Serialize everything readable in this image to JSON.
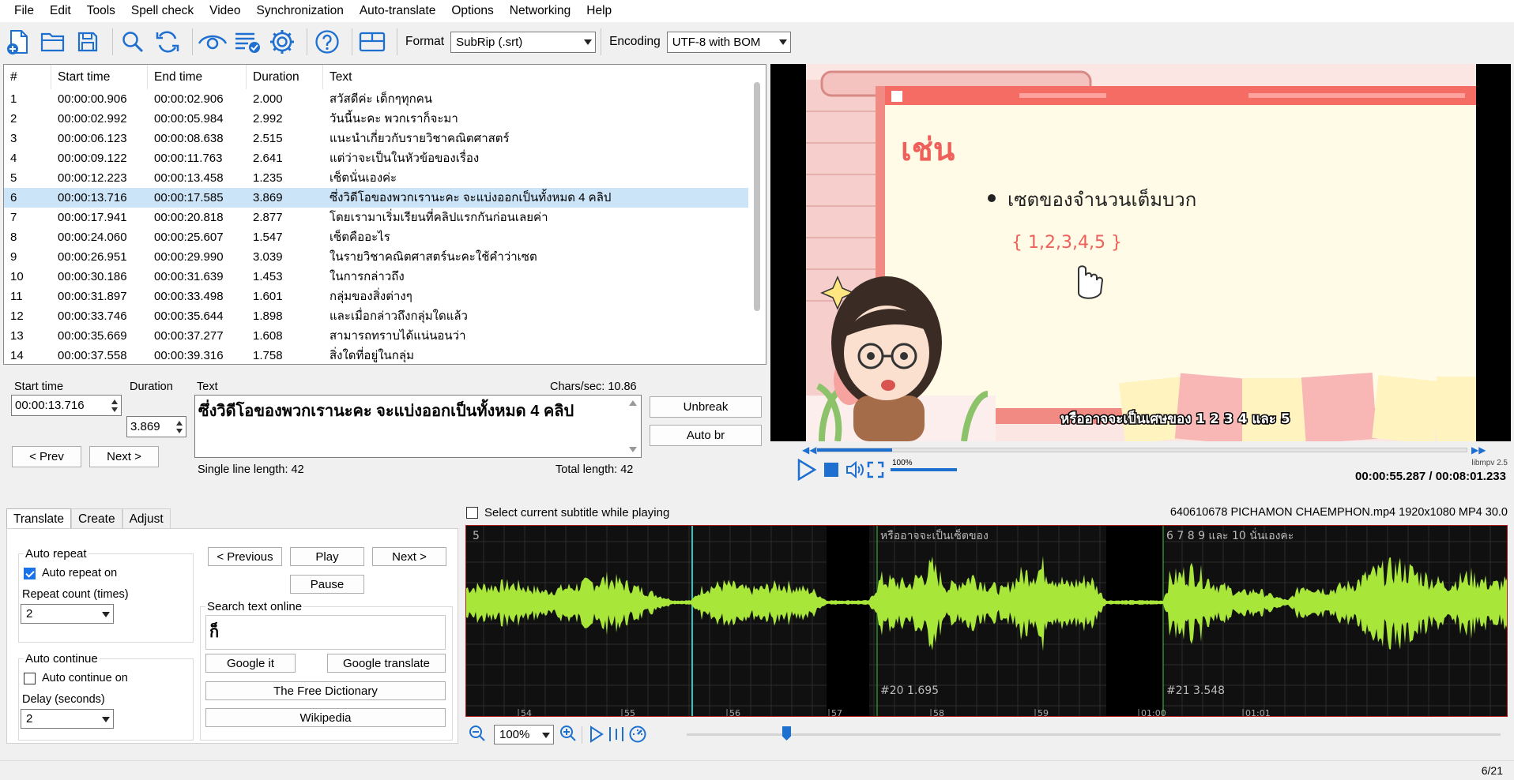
{
  "menu": [
    "File",
    "Edit",
    "Tools",
    "Spell check",
    "Video",
    "Synchronization",
    "Auto-translate",
    "Options",
    "Networking",
    "Help"
  ],
  "toolbar": {
    "icons": [
      "new-file-icon",
      "open-folder-icon",
      "save-icon",
      "find-icon",
      "replace-icon",
      "visual-sync-icon",
      "spell-check-icon",
      "settings-icon",
      "help-icon",
      "layout-icon"
    ],
    "format_label": "Format",
    "format_value": "SubRip (.srt)",
    "encoding_label": "Encoding",
    "encoding_value": "UTF-8 with BOM"
  },
  "list": {
    "columns": [
      "#",
      "Start time",
      "End time",
      "Duration",
      "Text"
    ],
    "selected_index": 5,
    "rows": [
      [
        "1",
        "00:00:00.906",
        "00:00:02.906",
        "2.000",
        "สวัสดีค่ะ เด็กๆทุกคน"
      ],
      [
        "2",
        "00:00:02.992",
        "00:00:05.984",
        "2.992",
        "วันนี้นะคะ พวกเราก็จะมา"
      ],
      [
        "3",
        "00:00:06.123",
        "00:00:08.638",
        "2.515",
        "แนะนำเกี่ยวกับรายวิชาคณิตศาสตร์"
      ],
      [
        "4",
        "00:00:09.122",
        "00:00:11.763",
        "2.641",
        "แต่ว่าจะเป็นในหัวข้อของเรื่อง"
      ],
      [
        "5",
        "00:00:12.223",
        "00:00:13.458",
        "1.235",
        "เซ็ตนั่นเองค่ะ"
      ],
      [
        "6",
        "00:00:13.716",
        "00:00:17.585",
        "3.869",
        "ซึ่งวิดีโอของพวกเรานะคะ จะแบ่งออกเป็นทั้งหมด 4 คลิป"
      ],
      [
        "7",
        "00:00:17.941",
        "00:00:20.818",
        "2.877",
        "โดยเรามาเริ่มเรียนที่คลิปแรกกันก่อนเลยค่า"
      ],
      [
        "8",
        "00:00:24.060",
        "00:00:25.607",
        "1.547",
        "เซ็ตคืออะไร"
      ],
      [
        "9",
        "00:00:26.951",
        "00:00:29.990",
        "3.039",
        "ในรายวิชาคณิตศาสตร์นะคะใช้คำว่าเซต"
      ],
      [
        "10",
        "00:00:30.186",
        "00:00:31.639",
        "1.453",
        "ในการกล่าวถึง"
      ],
      [
        "11",
        "00:00:31.897",
        "00:00:33.498",
        "1.601",
        "กลุ่มของสิ่งต่างๆ"
      ],
      [
        "12",
        "00:00:33.746",
        "00:00:35.644",
        "1.898",
        "และเมื่อกล่าวถึงกลุ่มใดแล้ว"
      ],
      [
        "13",
        "00:00:35.669",
        "00:00:37.277",
        "1.608",
        "สามารถทราบได้แน่นอนว่า"
      ],
      [
        "14",
        "00:00:37.558",
        "00:00:39.316",
        "1.758",
        "สิ่งใดที่อยู่ในกลุ่ม"
      ]
    ]
  },
  "editor": {
    "start_label": "Start time",
    "start_value": "00:00:13.716",
    "duration_label": "Duration",
    "duration_value": "3.869",
    "text_label": "Text",
    "chars_sec": "Chars/sec: 10.86",
    "text_value": "ซึ่งวิดีโอของพวกเรานะคะ จะแบ่งออกเป็นทั้งหมด 4 คลิป",
    "prev": "< Prev",
    "next": "Next >",
    "unbreak": "Unbreak",
    "auto_br": "Auto br",
    "single_line": "Single line length: 42",
    "total_length": "Total length: 42"
  },
  "video": {
    "heading": "เช่น",
    "bullet": "เซตของจำนวนเต็มบวก",
    "set_text": "{ 1,2,3,4,5 }",
    "subtitle": "หรืออาจจะเป็นเศษของ 1 2 3 4 และ 5",
    "volume_label": "100%",
    "player": "libmpv 2.5",
    "time": "00:00:55.287 / 00:08:01.233",
    "progress": 0.115,
    "volume": 1.0
  },
  "tabs": [
    "Translate",
    "Create",
    "Adjust"
  ],
  "translate": {
    "auto_repeat_title": "Auto repeat",
    "auto_repeat_on": "Auto repeat on",
    "repeat_count_label": "Repeat count (times)",
    "repeat_count": "2",
    "auto_continue_title": "Auto continue",
    "auto_continue_on": "Auto continue on",
    "delay_label": "Delay (seconds)",
    "delay": "2",
    "previous": "< Previous",
    "play": "Play",
    "next": "Next >",
    "pause": "Pause",
    "search_title": "Search text online",
    "search_value": "ก็",
    "google_it": "Google it",
    "google_translate": "Google translate",
    "free_dictionary": "The Free Dictionary",
    "wikipedia": "Wikipedia"
  },
  "waveform": {
    "select_while_playing": "Select current subtitle while playing",
    "file_info": "640610678 PICHAMON CHAEMPHON.mp4 1920x1080 MP4 30.0",
    "seg_left_num": "5",
    "seg1_text": "หรืออาจจะเป็นเซ็ตของ",
    "seg1_info": "#20  1.695",
    "seg2_text": "6 7 8 9 และ 10 นั่นเองคะ",
    "seg2_info": "#21  3.548",
    "ticks": [
      "54",
      "55",
      "56",
      "57",
      "58",
      "59",
      "01:00",
      "01:01"
    ],
    "zoom": "100%",
    "color": "#a8e63a"
  },
  "status": {
    "count": "6/21"
  }
}
